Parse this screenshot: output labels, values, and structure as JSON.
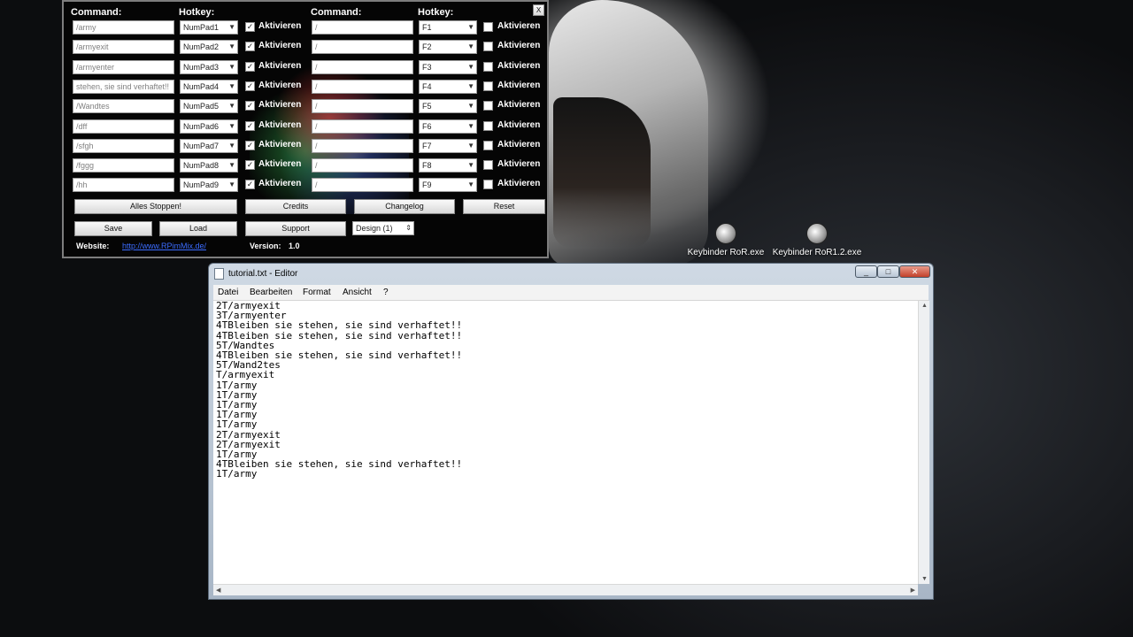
{
  "keybinder": {
    "header_command": "Command:",
    "header_hotkey": "Hotkey:",
    "close_label": "X",
    "activate_label": "Aktivieren",
    "left_rows": [
      {
        "command": "/army",
        "hotkey": "NumPad1",
        "checked": true
      },
      {
        "command": "/armyexit",
        "hotkey": "NumPad2",
        "checked": true
      },
      {
        "command": "/armyenter",
        "hotkey": "NumPad3",
        "checked": true
      },
      {
        "command": "stehen, sie sind verhaftet!!",
        "hotkey": "NumPad4",
        "checked": true
      },
      {
        "command": "/Wandtes",
        "hotkey": "NumPad5",
        "checked": true
      },
      {
        "command": "/dff",
        "hotkey": "NumPad6",
        "checked": true
      },
      {
        "command": "/sfgh",
        "hotkey": "NumPad7",
        "checked": true
      },
      {
        "command": "/fggg",
        "hotkey": "NumPad8",
        "checked": true
      },
      {
        "command": "/hh",
        "hotkey": "NumPad9",
        "checked": true
      }
    ],
    "right_rows": [
      {
        "command": "/",
        "hotkey": "F1",
        "checked": false
      },
      {
        "command": "/",
        "hotkey": "F2",
        "checked": false
      },
      {
        "command": "/",
        "hotkey": "F3",
        "checked": false
      },
      {
        "command": "/",
        "hotkey": "F4",
        "checked": false
      },
      {
        "command": "/",
        "hotkey": "F5",
        "checked": false
      },
      {
        "command": "/",
        "hotkey": "F6",
        "checked": false
      },
      {
        "command": "/",
        "hotkey": "F7",
        "checked": false
      },
      {
        "command": "/",
        "hotkey": "F8",
        "checked": false
      },
      {
        "command": "/",
        "hotkey": "F9",
        "checked": false
      }
    ],
    "buttons": {
      "stop_all": "Alles Stoppen!",
      "credits": "Credits",
      "changelog": "Changelog",
      "reset": "Reset",
      "save": "Save",
      "load": "Load",
      "support": "Support"
    },
    "design_value": "Design (1)",
    "website_label": "Website:",
    "website_link": "http://www.RPimMix.de/",
    "version_label": "Version:",
    "version_value": "1.0"
  },
  "desktop_icons": [
    {
      "label": "Keybinder RoR.exe"
    },
    {
      "label": "Keybinder RoR1.2.exe"
    }
  ],
  "notepad": {
    "title": "tutorial.txt - Editor",
    "menu": [
      "Datei",
      "Bearbeiten",
      "Format",
      "Ansicht",
      "?"
    ],
    "lines": [
      "2T/armyexit",
      "3T/armyenter",
      "4TBleiben sie stehen, sie sind verhaftet!!",
      "4TBleiben sie stehen, sie sind verhaftet!!",
      "5T/Wandtes",
      "4TBleiben sie stehen, sie sind verhaftet!!",
      "5T/Wand2tes",
      "T/armyexit",
      "1T/army",
      "1T/army",
      "1T/army",
      "1T/army",
      "1T/army",
      "2T/armyexit",
      "2T/armyexit",
      "1T/army",
      "4TBleiben sie stehen, sie sind verhaftet!!",
      "1T/army"
    ]
  }
}
